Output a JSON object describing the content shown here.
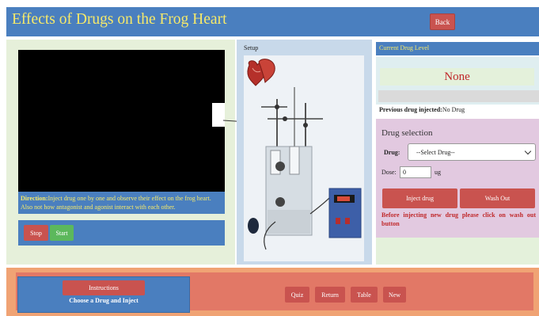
{
  "header": {
    "title": "Effects of Drugs on the Frog Heart",
    "back_label": "Back"
  },
  "simulation": {
    "direction_label": "Direction:",
    "direction_text": "Inject drug one by one and observe their effect on the frog heart. Also not how antagonist and agonist interact with each other.",
    "stop_label": "Stop",
    "start_label": "Start"
  },
  "setup": {
    "label": "Setup"
  },
  "drug_level": {
    "header": "Current Drug Level",
    "value": "None",
    "previous_label": "Previous drug injected:",
    "previous_value": "No Drug"
  },
  "drug_selection": {
    "heading": "Drug selection",
    "drug_label": "Drug:",
    "drug_selected": "--Select Drug--",
    "dose_label": "Dose:",
    "dose_value": "0",
    "dose_unit": "ug",
    "inject_label": "Inject drug",
    "wash_label": "Wash Out",
    "warning": "Before injecting new drug please click on wash out button"
  },
  "footer": {
    "instructions_label": "Instructions",
    "instructions_text": "Choose a Drug and Inject",
    "buttons": [
      "Quiz",
      "Return",
      "Table",
      "New"
    ]
  },
  "colors": {
    "primary_blue": "#4a7fbf",
    "accent_yellow": "#f6e96a",
    "button_red": "#c9534f",
    "start_green": "#5cb85c",
    "footer_orange": "#f0a374"
  }
}
